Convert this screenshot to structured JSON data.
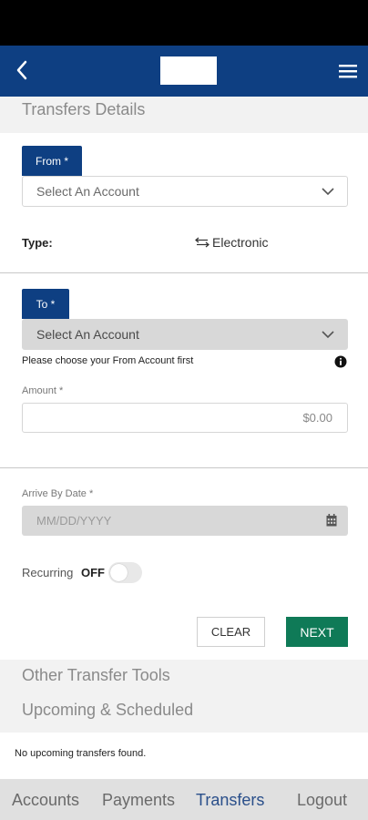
{
  "header": {
    "back_icon": "chevron-left-icon",
    "menu_icon": "hamburger-menu-icon",
    "brand_color": "#0e3f82"
  },
  "section_title": "Transfers Details",
  "from": {
    "label": "From *",
    "placeholder": "Select An Account"
  },
  "type": {
    "label": "Type:",
    "icon": "swap-arrows-icon",
    "value": "Electronic"
  },
  "to": {
    "label": "To *",
    "placeholder": "Select An Account",
    "help_text": "Please choose your From Account first"
  },
  "amount": {
    "label": "Amount *",
    "value": "$0.00"
  },
  "arrive_by": {
    "label": "Arrive By Date *",
    "placeholder": "MM/DD/YYYY"
  },
  "recurring": {
    "label": "Recurring",
    "state": "OFF"
  },
  "actions": {
    "clear_label": "CLEAR",
    "next_label": "NEXT",
    "next_color": "#0f7a57"
  },
  "tools": {
    "other_label": "Other Transfer Tools",
    "upcoming_label": "Upcoming & Scheduled",
    "empty_text": "No upcoming transfers found."
  },
  "bottom_nav": {
    "items": [
      "Accounts",
      "Payments",
      "Transfers",
      "Logout"
    ],
    "active": "Transfers"
  }
}
